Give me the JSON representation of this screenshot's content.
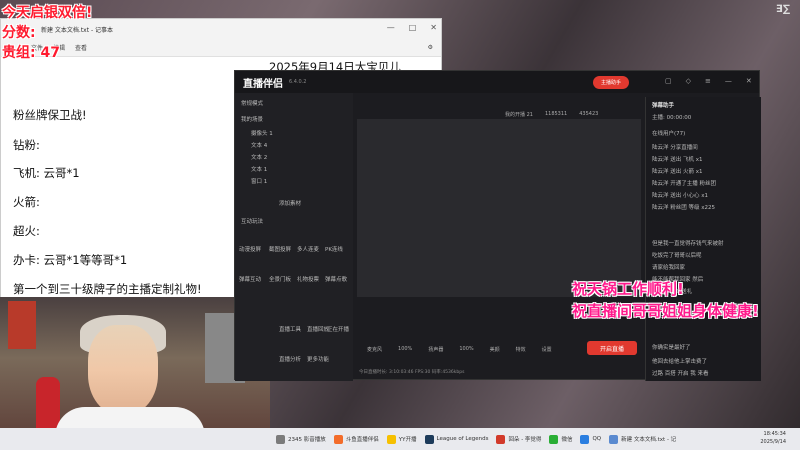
{
  "overlay": {
    "line1": "今天启银双倍!",
    "line2": "分数:",
    "line3": "贵组: 47"
  },
  "notepad": {
    "title": "新建 文本文档.txt - 记事本",
    "tabs": [
      "文件",
      "编辑",
      "查看"
    ],
    "date": "2025年9月14日大宝贝儿",
    "lines": [
      "粉丝牌保卫战!",
      "钻粉:",
      "飞机: 云哥*1",
      "火箭:",
      "超火:",
      "办卡: 云哥*1等等哥*1",
      "第一个到三十级牌子的主播定制礼物!"
    ]
  },
  "studio": {
    "logo": "直播伴侣",
    "version": "6.4.0.2",
    "start_live_top": "主播助手",
    "scene_label": "常规模式",
    "my_scenes": "我的场景",
    "scene_items": [
      "摄像头 1",
      "文本 4",
      "文本 2",
      "文本 1",
      "窗口 1"
    ],
    "add_material": "添加素材",
    "interactive_title": "互动玩法",
    "interactive_items": [
      "动漫投屏",
      "截图投屏",
      "多人连麦",
      "PK连线",
      "弹幕互动",
      "全景门板",
      "礼物投票",
      "弹幕点歌"
    ],
    "tools": [
      "直播工具",
      "直播回放",
      "正在开播",
      "直播分析",
      "更多功能"
    ],
    "stats": [
      "我的开播 21",
      "1185311",
      "435423"
    ],
    "mic_label": "麦克风",
    "mic_pct": "100%",
    "speaker_label": "扬声器",
    "speaker_pct": "100%",
    "toolbar_items": [
      "美颜",
      "特效",
      "设置"
    ],
    "start_button": "开启直播",
    "status_bar": "今日直播时长: 3:10:03:46  FPS:30  码率:4536kbps",
    "right": {
      "title": "弹幕助手",
      "online": "主播: 00:00:00",
      "rows": [
        "在线用户(77)",
        "陆云洋 分享直播间",
        "陆云洋 送出 飞机 x1",
        "陆云洋 送出 火箭 x1",
        "陆云洋 开通了主播 粉丝团",
        "陆云洋 送出 小心心 x1",
        "陆云洋 粉丝团 等级 x225",
        "但是我一直觉得存钱气来被射",
        "吃饭完了哥哥以后呢",
        "请家给我回家",
        "能不能帮我回家 然后",
        "陆云洋 开始送礼",
        "你确实是最好了",
        "他回去给他上掌击费了",
        "过路 百搭 开启 我 来看"
      ]
    }
  },
  "blessings": {
    "line1": "祝天锅工作顺利!",
    "line2": "祝直播间哥哥姐姐身体健康!"
  },
  "taskbar": {
    "items": [
      "2345 影音播放",
      "斗鱼直播伴侣",
      "YY开播",
      "League of Legends",
      "回朵 - 李觉得",
      "微信",
      "QQ",
      "新建 文本文档.txt - 记"
    ],
    "time": "18:45:34",
    "date": "2025/9/14"
  },
  "colors": {
    "accent_red": "#e1392f",
    "overlay_red": "#ff1a2e",
    "overlay_pink": "#ff1a8c"
  }
}
